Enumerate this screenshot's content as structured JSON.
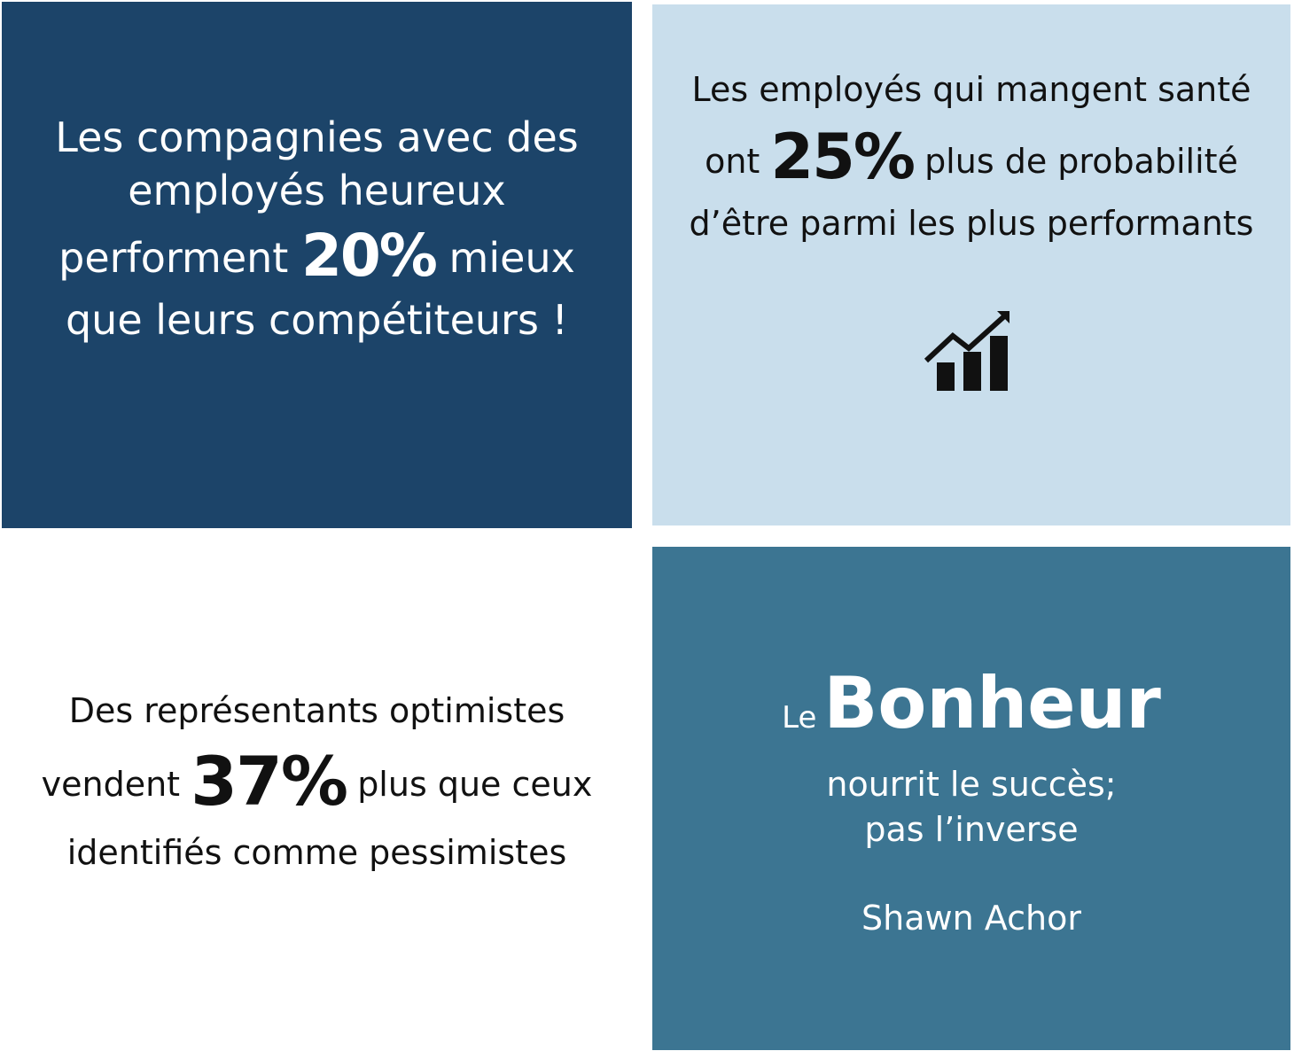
{
  "panels": {
    "top_left": {
      "line1": "Les compagnies avec des",
      "line2": "employés heureux",
      "line3_before": "performent",
      "stat": "20%",
      "line3_after": "mieux",
      "line4": "que leurs compétiteurs !",
      "background": "#1c4469"
    },
    "top_right": {
      "line1": "Les employés qui mangent santé",
      "line2_before": "ont",
      "stat": "25%",
      "line2_after": "plus de probabilité",
      "line3": "d’être parmi les plus performants",
      "icon": "growth-chart-icon",
      "background": "#c9deec"
    },
    "bottom_left": {
      "line1": "Des représentants optimistes",
      "line2_before": "vendent",
      "stat": "37%",
      "line2_after": "plus que ceux",
      "line3": "identifiés comme pessimistes",
      "background": "#ffffff"
    },
    "bottom_right": {
      "le": "Le",
      "bonheur": "Bonheur",
      "line2": "nourrit le succès;",
      "line3": "pas l’inverse",
      "author": "Shawn Achor",
      "background": "#3c7592"
    }
  }
}
